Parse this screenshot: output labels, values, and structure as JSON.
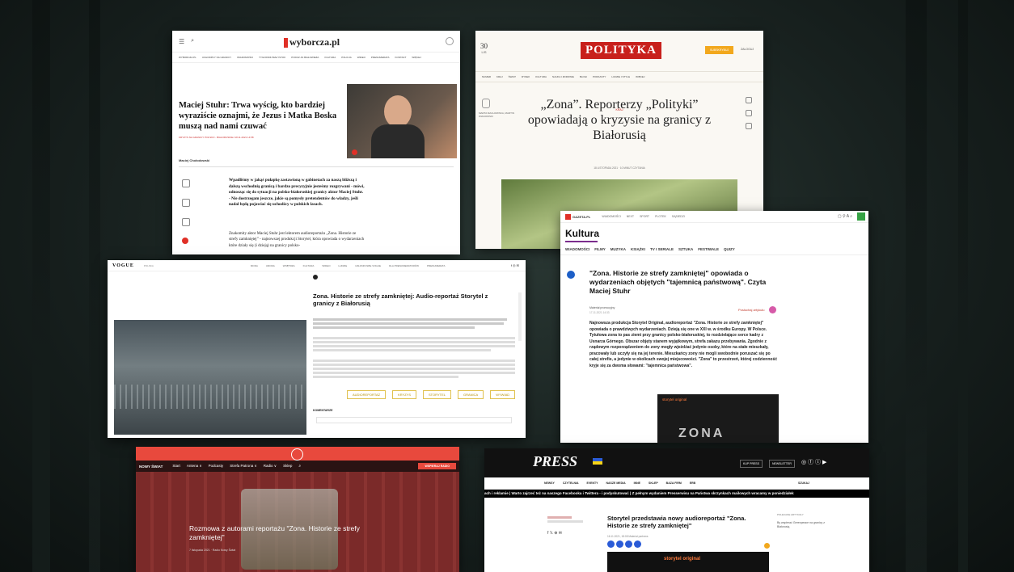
{
  "wyborcza": {
    "logo": "wyborcza.pl",
    "nav": [
      "WYBORCZA.PL",
      "UCHODŹCY NA GRANICY",
      "WIADOMOŚCI",
      "TYGODNIK BIAŁYSTOK",
      "PODCZ.JN BIAŁOWIEŻA",
      "KULTURA",
      "POLICJA",
      "WIDEO",
      "PRENUMERATA",
      "KONTAKT",
      "WIĘCEJ"
    ],
    "headline": "Maciej Stuhr: Trwa wyścig, kto bardziej wyraziście oznajmi, że Jezus i Matka Boska muszą nad nami czuwać",
    "tags": "KRYZYS NA GRANICY POLSKO - BIAŁORUSKIEJ   18.11.2021 14:58",
    "author": "Maciej Chołodowski",
    "lead": "Wpadliśmy w jakąś pułapkę zastawioną w gabinetach za naszą bliższą i dalszą wschodnią granicą i bardzo precyzyjnie jesteśmy rozgrywani - mówi, odnosząc się do sytuacji na polsko-białoruskiej granicy aktor Maciej Stuhr. - Nie dostrzegam jeszcze, jakie są pomysły pretendentów do władzy, jeśli nadal będą pojawiać się uchodźcy w polskich lasach.",
    "para": "Znakomity aktor Maciej Stuhr jest lektorem audioreportażu „Zona. Historie ze strefy zamkniętej” - najnowszej produkcji Storytel, która opowiada o wydarzeniach które działy się (i dzieją) na granicy polsko-"
  },
  "polityka": {
    "logo": "POLITYKA",
    "date_day": "30",
    "date_month": "LIS",
    "button": "SUBSKRYBUJ",
    "account": "ZALOGUJ",
    "nav": [
      "NUMER",
      "KRAJ",
      "ŚWIAT",
      "RYNEK",
      "KULTURA",
      "NAUKA I ZDROWIE",
      "BLOGI",
      "PODKASTY",
      "LUDZIE I STYLE",
      "WIĘCEJ"
    ],
    "kicker": "KRAJ",
    "author": "MARTA MACHOWSKA, MARTIN WIANOWSKI",
    "headline": "„Zona”. Reporterzy „Polityki” opowiadają o kryzysie na granicy z Białorusią",
    "meta": "18 LISTOPADA 2021   ·   10 MINUT CZYTANIA"
  },
  "vogue": {
    "logo": "VOGUE",
    "brand": "POLSKA",
    "nav": [
      "MODA",
      "URODA",
      "WNĘTRZA",
      "KULTURA",
      "WIDEO",
      "LUDZIE",
      "CZŁONKOWIE VOGUE",
      "DLA PRENUMERATORÓW",
      "PRENUMERATA"
    ],
    "headline": "Zona. Historie ze strefy zamkniętej: Audio-reportaż Storytel z granicy z Białorusią",
    "tags": [
      "AUDIOREPORTAŻ",
      "KRYZYS",
      "STORYTEL",
      "GRANICA",
      "WYWIAD"
    ],
    "comments": "KOMENTARZE"
  },
  "gazeta": {
    "portal": "GAZETA.PL",
    "topnav": [
      "WIADOMOŚCI",
      "NEXT",
      "SPORT",
      "PLOTEK",
      "SĄSIEDZI"
    ],
    "section": "Kultura",
    "subnav": [
      "WIADOMOŚCI",
      "FILMY",
      "MUZYKA",
      "KSIĄŻKI",
      "TV I SERIALE",
      "SZTUKA",
      "FESTIWALE",
      "QUIZY"
    ],
    "headline": "\"Zona. Historie ze strefy zamkniętej\" opowiada o wydarzeniach objętych \"tajemnicą państwową\". Czyta Maciej Stuhr",
    "sponsor": "Materiał promocyjny",
    "date": "17.11.2021 14:33",
    "listen": "Posłuchaj artykułu",
    "body": "Najnowsza produkcja Storytel Original, audioreportaż \"Zona. Historie ze strefy zamkniętej\" opowiada o prawdziwych wydarzeniach. Dzieją się one w XXI w. w środku Europy. W Polsce. Tytułowa zona to pas ziemi przy granicy polsko-białoruskiej, to rozdzielające serce kadry z Usnarza Górnego. Obszar objęty stanem wyjątkowym, strefa zakazu przebywania. Zgodnie z rządowym rozporządzeniem do zony mogły wjeżdżać jedynie osoby, które na stałe mieszkały, pracowały lub uczyły się na jej terenie. Mieszkańcy zony nie mogli swobodnie poruszać się po całej strefie, a jedynie w okolicach swojej miejscowości. \"Zona\" to przestrzeń, której codzienność kryje się za dwoma słowami: \"tajemnica państwowa\".",
    "storytel": "storytel original",
    "poster": "ZONA"
  },
  "nowyswiat": {
    "logo": "NOWY ŚWIAT",
    "nav": [
      "Start",
      "Antena ∨",
      "Podcasty",
      "Strefa Patrona ∨",
      "Radio ∨",
      "Sklep"
    ],
    "button": "WSPIERAJ RADIO",
    "headline": "Rozmowa z autorami reportażu \"Zona. Historie ze strefy zamkniętej\"",
    "meta": "7 listopada 2021   ·   Radio Nowy Świat"
  },
  "press": {
    "logo": "PRESS",
    "toplinks": [
      "KUP PRESS",
      "NEWSLETTER"
    ],
    "nav": [
      "NEWSY",
      "CZYTELNIA",
      "EVENTY",
      "NASZE MEDIA",
      "INNE",
      "SKLEP",
      "BAZA FIRM",
      "ERB"
    ],
    "search": "SZUKAJ",
    "ticker": "ach i reklamie  |  Warto zajrzeć też na naszego Facebooka i Twittera - i podyskutować  |  Z pełnym wydaniem Presserwisu na Państwa skrzynkach mailowych wracamy w poniedziałek",
    "headline": "Storytel przedstawia nowy audioreportaż \"Zona. Historie ze strefy zamkniętej\"",
    "meta": "16.11.2021, 18:08   Materiał partnera",
    "side_title": "POLECANE ARTYKUŁY",
    "side_text": "By wspierać Greenpeace na granicy z Białorusią",
    "storytel": "storytel original"
  },
  "colors": {
    "wyborcza_red": "#e03027",
    "polityka_red": "#c8201c",
    "polityka_yellow": "#f2a81d",
    "gazeta_green": "#35a244",
    "nowyswiat_red": "#e8493d",
    "press_blue": "#2a5bd7",
    "vogue_gold": "#e3c54a"
  }
}
